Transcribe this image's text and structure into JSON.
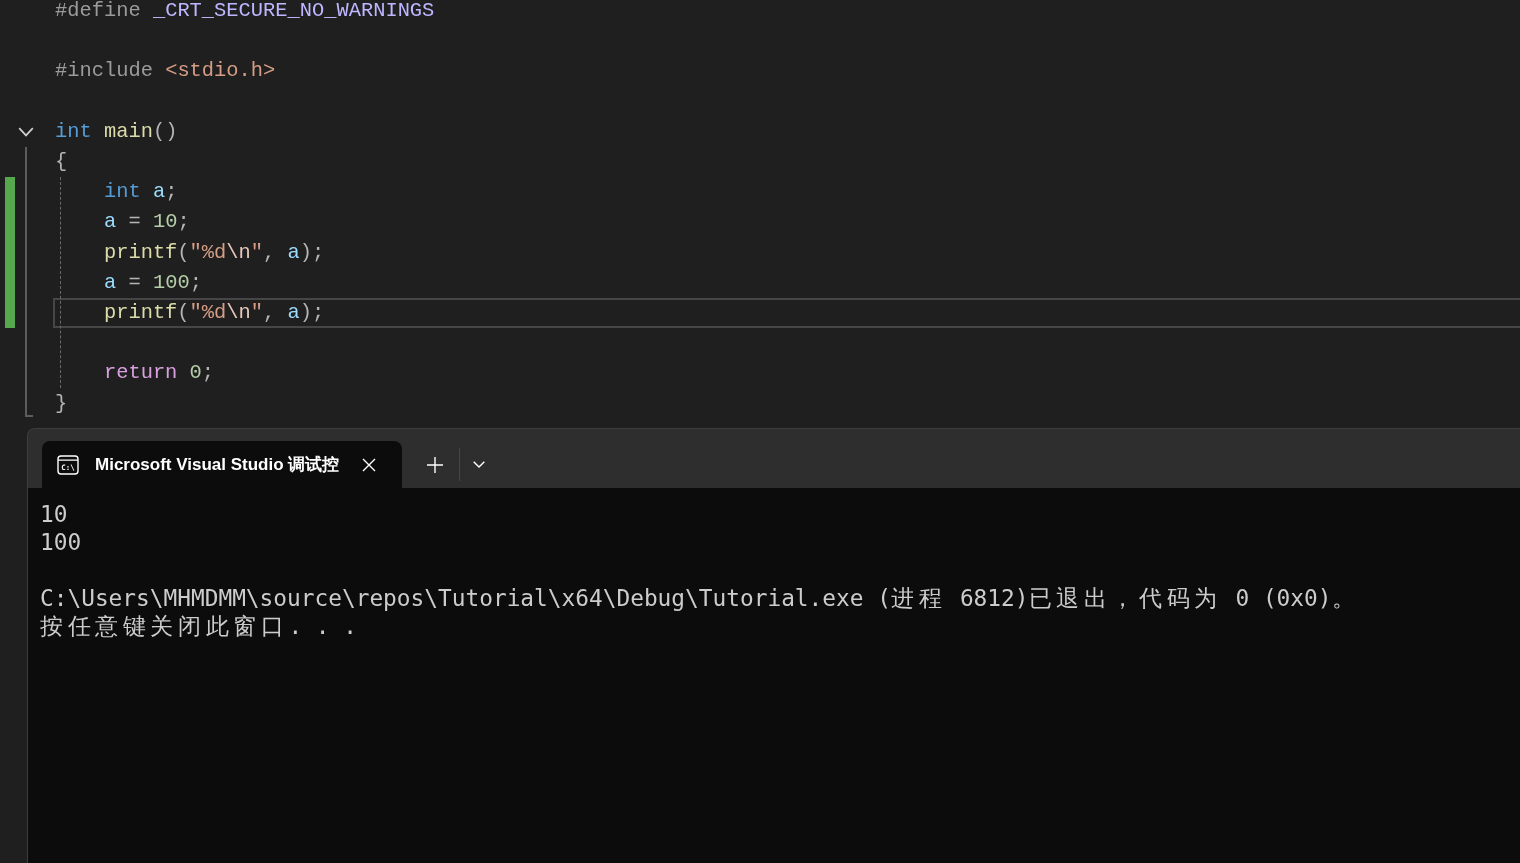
{
  "editor": {
    "lines": [
      {
        "kind": "line",
        "changed": false,
        "current": false,
        "tokens": [
          {
            "kind": "preprocessor",
            "text": "#define "
          },
          {
            "kind": "macro",
            "text": "_CRT_SECURE_NO_WARNINGS"
          }
        ]
      },
      {
        "kind": "blank"
      },
      {
        "kind": "line",
        "changed": false,
        "current": false,
        "tokens": [
          {
            "kind": "preprocessor",
            "text": "#include "
          },
          {
            "kind": "string",
            "text": "<stdio.h>"
          }
        ]
      },
      {
        "kind": "blank"
      },
      {
        "kind": "block",
        "expanded": true,
        "changed": false,
        "current": false,
        "tokens": [
          {
            "kind": "keyword",
            "text": "int "
          },
          {
            "kind": "function",
            "text": "main"
          },
          {
            "kind": "punct",
            "text": "()"
          }
        ],
        "open": {
          "changed": false,
          "current": false,
          "tokens": [
            {
              "kind": "punct",
              "text": "{"
            }
          ]
        },
        "children": [
          {
            "kind": "line",
            "changed": true,
            "current": false,
            "tokens": [
              {
                "kind": "keyword",
                "text": "int "
              },
              {
                "kind": "variable",
                "text": "a"
              },
              {
                "kind": "punct",
                "text": ";"
              }
            ]
          },
          {
            "kind": "line",
            "changed": true,
            "current": false,
            "tokens": [
              {
                "kind": "variable",
                "text": "a"
              },
              {
                "kind": "punct",
                "text": " = "
              },
              {
                "kind": "number",
                "text": "10"
              },
              {
                "kind": "punct",
                "text": ";"
              }
            ]
          },
          {
            "kind": "line",
            "changed": true,
            "current": false,
            "tokens": [
              {
                "kind": "function",
                "text": "printf"
              },
              {
                "kind": "punct",
                "text": "("
              },
              {
                "kind": "string",
                "text": "\"%d"
              },
              {
                "kind": "escape",
                "text": "\\n"
              },
              {
                "kind": "string",
                "text": "\""
              },
              {
                "kind": "punct",
                "text": ", "
              },
              {
                "kind": "variable",
                "text": "a"
              },
              {
                "kind": "punct",
                "text": ");"
              }
            ]
          },
          {
            "kind": "line",
            "changed": true,
            "current": false,
            "tokens": [
              {
                "kind": "variable",
                "text": "a"
              },
              {
                "kind": "punct",
                "text": " = "
              },
              {
                "kind": "number",
                "text": "100"
              },
              {
                "kind": "punct",
                "text": ";"
              }
            ]
          },
          {
            "kind": "line",
            "changed": true,
            "current": true,
            "tokens": [
              {
                "kind": "function",
                "text": "printf"
              },
              {
                "kind": "punct",
                "text": "("
              },
              {
                "kind": "string",
                "text": "\"%d"
              },
              {
                "kind": "escape",
                "text": "\\n"
              },
              {
                "kind": "string",
                "text": "\""
              },
              {
                "kind": "punct",
                "text": ", "
              },
              {
                "kind": "variable",
                "text": "a"
              },
              {
                "kind": "punct",
                "text": ");"
              }
            ]
          },
          {
            "kind": "blank"
          },
          {
            "kind": "line",
            "changed": false,
            "current": false,
            "tokens": [
              {
                "kind": "control",
                "text": "return "
              },
              {
                "kind": "number",
                "text": "0"
              },
              {
                "kind": "punct",
                "text": ";"
              }
            ]
          }
        ],
        "close": {
          "changed": false,
          "current": false,
          "tokens": [
            {
              "kind": "punct",
              "text": "}"
            }
          ]
        }
      }
    ]
  },
  "terminal": {
    "tabs": [
      {
        "title": "Microsoft Visual Studio 调试控",
        "icon_text": "C:\\",
        "selected": true
      }
    ],
    "output": [
      {
        "kind": "text",
        "text": "10"
      },
      {
        "kind": "text",
        "text": "100"
      },
      {
        "kind": "blank"
      },
      {
        "kind": "text",
        "text": "C:\\Users\\MHMDMM\\source\\repos\\Tutorial\\x64\\Debug\\Tutorial.exe (进程 6812)已退出，代码为 0 (0x0)。"
      },
      {
        "kind": "text",
        "text": "按任意键关闭此窗口. . ."
      }
    ]
  }
}
